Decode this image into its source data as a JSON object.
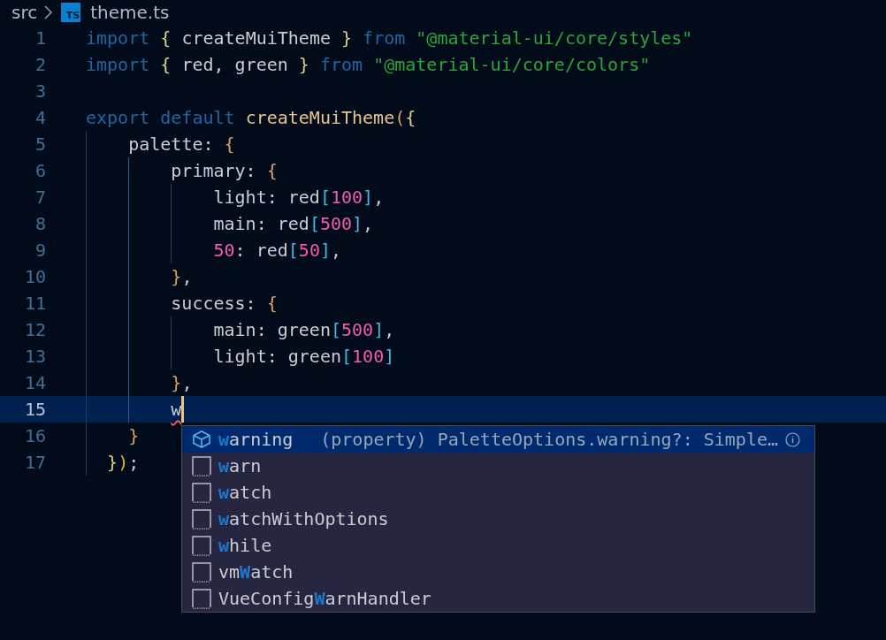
{
  "breadcrumb": {
    "folder": "src",
    "file_badge": "TS",
    "file": "theme.ts"
  },
  "lines": [
    {
      "number": "1",
      "current": false,
      "tokens": [
        {
          "text": "import ",
          "kind": "keyword"
        },
        {
          "text": "{",
          "kind": "brace"
        },
        {
          "text": " createMuiTheme ",
          "kind": "plain"
        },
        {
          "text": "}",
          "kind": "brace"
        },
        {
          "text": " from",
          "kind": "keyword"
        },
        {
          "text": " \"@material-ui/core/styles\"",
          "kind": "string"
        }
      ]
    },
    {
      "number": "2",
      "current": false,
      "tokens": [
        {
          "text": "import ",
          "kind": "keyword"
        },
        {
          "text": "{",
          "kind": "brace"
        },
        {
          "text": " red, green ",
          "kind": "plain"
        },
        {
          "text": "}",
          "kind": "brace"
        },
        {
          "text": " from",
          "kind": "keyword"
        },
        {
          "text": " \"@material-ui/core/colors\"",
          "kind": "string"
        }
      ]
    },
    {
      "number": "3",
      "current": false
    },
    {
      "number": "4",
      "current": false,
      "tokens": [
        {
          "text": "export default ",
          "kind": "keyword"
        },
        {
          "text": "createMuiTheme",
          "kind": "function"
        },
        {
          "text": "(",
          "kind": "paren"
        },
        {
          "text": "{",
          "kind": "brace"
        }
      ]
    },
    {
      "number": "5",
      "current": false,
      "tokens": [
        {
          "text": "    palette: ",
          "kind": "plain"
        },
        {
          "text": "{",
          "kind": "paren"
        }
      ]
    },
    {
      "number": "6",
      "current": false,
      "tokens": [
        {
          "text": "        primary: ",
          "kind": "plain"
        },
        {
          "text": "{",
          "kind": "paren"
        }
      ]
    },
    {
      "number": "7",
      "current": false,
      "tokens": [
        {
          "text": "            light: red",
          "kind": "plain"
        },
        {
          "text": "[",
          "kind": "bracket"
        },
        {
          "text": "100",
          "kind": "number"
        },
        {
          "text": "]",
          "kind": "bracket"
        },
        {
          "text": ",",
          "kind": "plain"
        }
      ]
    },
    {
      "number": "8",
      "current": false,
      "tokens": [
        {
          "text": "            main: red",
          "kind": "plain"
        },
        {
          "text": "[",
          "kind": "bracket"
        },
        {
          "text": "500",
          "kind": "number"
        },
        {
          "text": "]",
          "kind": "bracket"
        },
        {
          "text": ",",
          "kind": "plain"
        }
      ]
    },
    {
      "number": "9",
      "current": false,
      "tokens": [
        {
          "text": "            50",
          "kind": "number"
        },
        {
          "text": ": red",
          "kind": "plain"
        },
        {
          "text": "[",
          "kind": "bracket"
        },
        {
          "text": "50",
          "kind": "number"
        },
        {
          "text": "]",
          "kind": "bracket"
        },
        {
          "text": ",",
          "kind": "plain"
        }
      ]
    },
    {
      "number": "10",
      "current": false,
      "tokens": [
        {
          "text": "        }",
          "kind": "paren"
        },
        {
          "text": ",",
          "kind": "plain"
        }
      ]
    },
    {
      "number": "11",
      "current": false,
      "tokens": [
        {
          "text": "        success: ",
          "kind": "plain"
        },
        {
          "text": "{",
          "kind": "paren"
        }
      ]
    },
    {
      "number": "12",
      "current": false,
      "tokens": [
        {
          "text": "            main: green",
          "kind": "plain"
        },
        {
          "text": "[",
          "kind": "bracket"
        },
        {
          "text": "500",
          "kind": "number"
        },
        {
          "text": "]",
          "kind": "bracket"
        },
        {
          "text": ",",
          "kind": "plain"
        }
      ]
    },
    {
      "number": "13",
      "current": false,
      "tokens": [
        {
          "text": "            light: green",
          "kind": "plain"
        },
        {
          "text": "[",
          "kind": "bracket"
        },
        {
          "text": "100",
          "kind": "number"
        },
        {
          "text": "]",
          "kind": "bracket"
        }
      ]
    },
    {
      "number": "14",
      "current": false,
      "tokens": [
        {
          "text": "        }",
          "kind": "paren"
        },
        {
          "text": ",",
          "kind": "plain"
        }
      ]
    },
    {
      "number": "15",
      "current": true,
      "tokens": [
        {
          "text": "        w",
          "kind": "error"
        }
      ]
    },
    {
      "number": "16",
      "current": false,
      "tokens": [
        {
          "text": "    }",
          "kind": "paren"
        }
      ]
    },
    {
      "number": "17",
      "current": false,
      "tokens": [
        {
          "text": "  }",
          "kind": "brace"
        },
        {
          "text": ")",
          "kind": "paren2"
        },
        {
          "text": ";",
          "kind": "plain"
        }
      ]
    }
  ],
  "suggestions": [
    {
      "kind": "property",
      "selected": true,
      "parts": [
        {
          "text": "w",
          "match": true
        },
        {
          "text": "arning",
          "match": false
        }
      ],
      "detail": "(property) PaletteOptions.warning?: Simple…"
    },
    {
      "kind": "text",
      "selected": false,
      "parts": [
        {
          "text": "w",
          "match": true
        },
        {
          "text": "arn",
          "match": false
        }
      ]
    },
    {
      "kind": "text",
      "selected": false,
      "parts": [
        {
          "text": "w",
          "match": true
        },
        {
          "text": "atch",
          "match": false
        }
      ]
    },
    {
      "kind": "text",
      "selected": false,
      "parts": [
        {
          "text": "w",
          "match": true
        },
        {
          "text": "atchWithOptions",
          "match": false
        }
      ]
    },
    {
      "kind": "text",
      "selected": false,
      "parts": [
        {
          "text": "w",
          "match": true
        },
        {
          "text": "hile",
          "match": false
        }
      ]
    },
    {
      "kind": "text",
      "selected": false,
      "parts": [
        {
          "text": "vm",
          "match": false
        },
        {
          "text": "W",
          "match": true
        },
        {
          "text": "atch",
          "match": false
        }
      ]
    },
    {
      "kind": "text",
      "selected": false,
      "parts": [
        {
          "text": "VueConfig",
          "match": false
        },
        {
          "text": "W",
          "match": true
        },
        {
          "text": "arnHandler",
          "match": false
        }
      ]
    }
  ]
}
